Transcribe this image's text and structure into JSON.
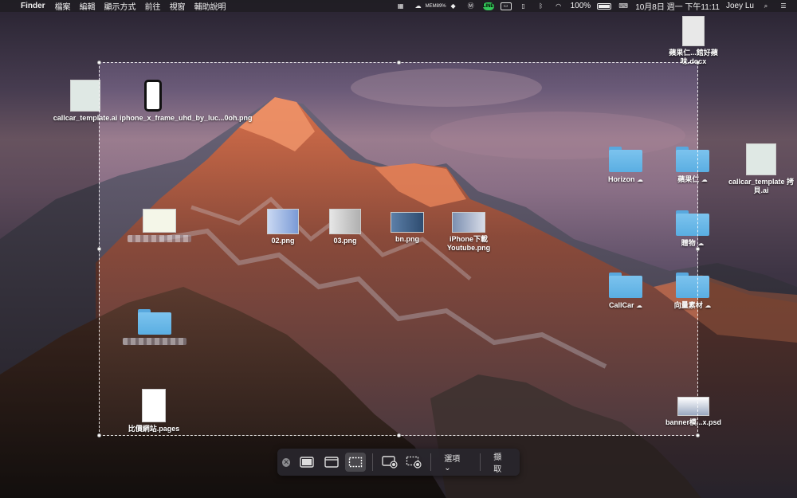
{
  "menubar": {
    "apple_glyph": "",
    "app_name": "Finder",
    "menus": [
      "檔案",
      "編輯",
      "顯示方式",
      "前往",
      "視窗",
      "輔助說明"
    ],
    "mem_label": "MEM",
    "mem_value": "89%",
    "line_label": "LINE",
    "battery_percent": "100%",
    "datetime": "10月8日 週一 下午11:11",
    "user": "Joey Lu",
    "tray_icons": [
      "grid-icon",
      "cloud-icon",
      "memory-icon",
      "dropbox-icon",
      "malwarebytes-icon",
      "line-icon",
      "airplay-icon",
      "battery-icon",
      "bluetooth-icon",
      "wifi-icon",
      "battery-icon",
      "keyboard-icon",
      "search-icon",
      "list-icon"
    ]
  },
  "desktop_icons": [
    {
      "label": "callcar_template.ai"
    },
    {
      "label": "iphone_x_frame_uhd_by_luc...0oh.png"
    },
    {
      "label": "02.png"
    },
    {
      "label": "03.png"
    },
    {
      "label": "bn.png"
    },
    {
      "label": "iPhone下載Youtube.png"
    },
    {
      "label": "比價網站.pages"
    },
    {
      "label": "蘋果仁"
    },
    {
      "label": "Horizon"
    },
    {
      "label": "callcar_template 拷貝.ai"
    },
    {
      "label": "贈物"
    },
    {
      "label": "CallCar"
    },
    {
      "label": "向量素材"
    },
    {
      "label": "banner模...x.psd"
    },
    {
      "label": "蘋果仁...館好蘋味.docx"
    }
  ],
  "toolbar": {
    "options_label": "選項",
    "capture_label": "擷取"
  },
  "colors": {
    "folder": "#6cb8e8",
    "menubar": "#1e1c22",
    "toolbar": "#28262c"
  }
}
